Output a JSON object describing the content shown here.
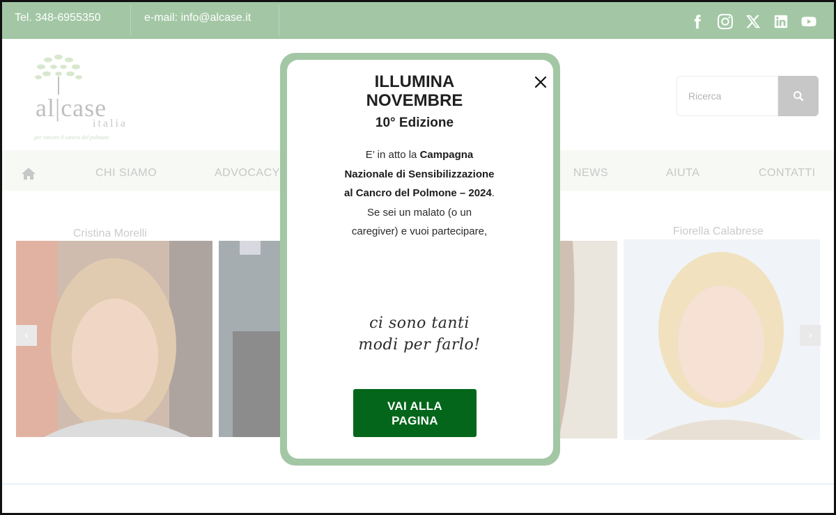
{
  "topbar": {
    "phone": "Tel. 348-6955350",
    "email": "e-mail: info@alcase.it",
    "social_icons": [
      "facebook-icon",
      "instagram-icon",
      "x-icon",
      "linkedin-icon",
      "youtube-icon"
    ]
  },
  "header": {
    "logo_word": "al|case",
    "logo_sub": "italia",
    "logo_tagline": "per vincere il cancro del polmone",
    "search_placeholder": "Ricerca"
  },
  "nav": {
    "items": [
      "CHI SIAMO",
      "ADVOCACY",
      "NEWS",
      "AIUTA",
      "CONTATTI"
    ]
  },
  "carousel": {
    "names": [
      "Cristina Morelli",
      "Fiorella Calabrese"
    ]
  },
  "modal": {
    "title": "ILLUMINA NOVEMBRE",
    "subtitle": "10° Edizione",
    "body_intro": "E’ in atto la ",
    "body_bold": "Campagna Nazionale di Sensibilizzazione al Cancro del Polmone – 2024",
    "body_rest": ".  Se sei un malato (o un caregiver) e vuoi partecipare,",
    "script_line1": "ci sono tanti",
    "script_line2": "modi per farlo!",
    "cta": "VAI ALLA PAGINA"
  },
  "colors": {
    "topbar": "#a3c7a5",
    "nav_bg": "#eef5ec",
    "cta_bg": "#04661a",
    "modal_border": "#a3c7a5"
  }
}
